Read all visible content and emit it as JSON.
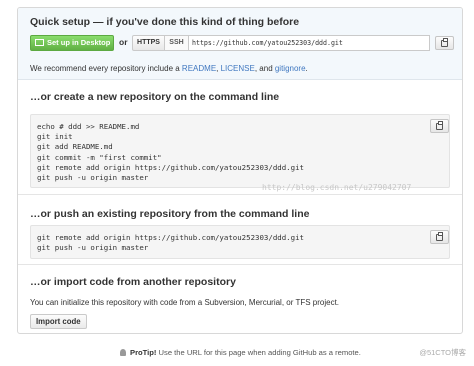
{
  "quick_setup": {
    "title": "Quick setup — if you've done this kind of thing before",
    "desktop_button": "Set up in Desktop",
    "or": "or",
    "protocols": [
      "HTTPS",
      "SSH"
    ],
    "selected_protocol": "HTTPS",
    "clone_url": "https://github.com/yatou252303/ddd.git",
    "recommend_text_1": "We recommend every repository include a ",
    "readme_link": "README",
    "sep_1": ", ",
    "license_link": "LICENSE",
    "sep_2": ", and ",
    "gitignore_link": "gitignore",
    "end": "."
  },
  "create_section": {
    "title": "…or create a new repository on the command line",
    "code": "echo # ddd >> README.md\ngit init\ngit add README.md\ngit commit -m \"first commit\"\ngit remote add origin https://github.com/yatou252303/ddd.git\ngit push -u origin master"
  },
  "push_section": {
    "title": "…or push an existing repository from the command line",
    "code": "git remote add origin https://github.com/yatou252303/ddd.git\ngit push -u origin master"
  },
  "import_section": {
    "title": "…or import code from another repository",
    "description": "You can initialize this repository with code from a Subversion, Mercurial, or TFS project.",
    "button": "Import code"
  },
  "watermark": "http://blog.csdn.net/u279042707",
  "protip": {
    "label": "ProTip!",
    "text": " Use the URL for this page when adding GitHub as a remote."
  },
  "corner_mark": "@51CTO博客",
  "colors": {
    "accent_green": "#60b044",
    "link_blue": "#4078c0",
    "quick_bg": "#f3f8fc"
  }
}
